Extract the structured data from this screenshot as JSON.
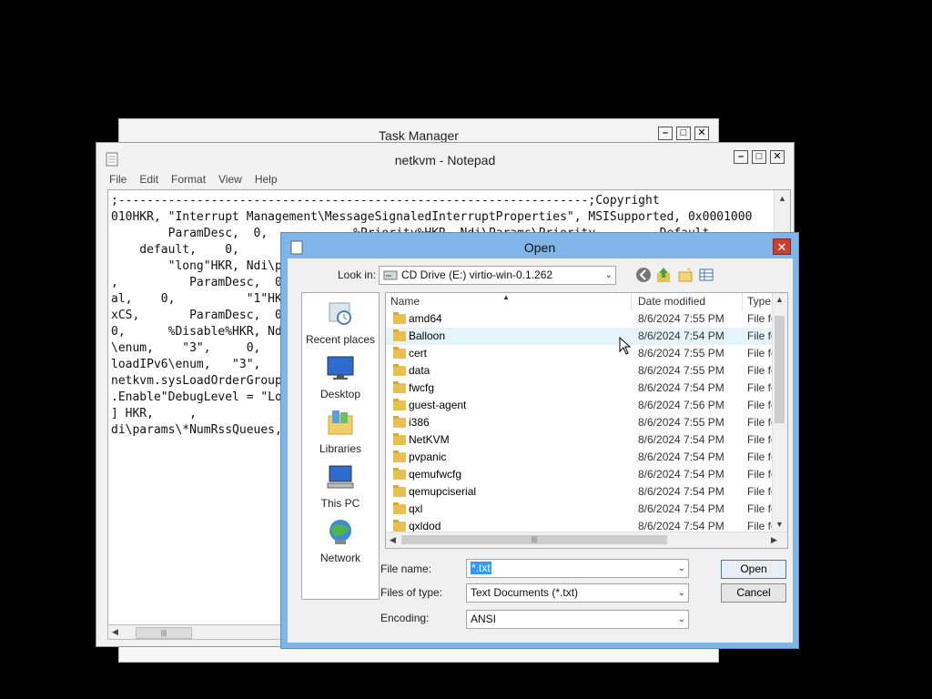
{
  "taskmanager": {
    "title": "Task Manager"
  },
  "notepad": {
    "title": "netkvm - Notepad",
    "menu": [
      "File",
      "Edit",
      "Format",
      "View",
      "Help"
    ],
    "text": ";------------------------------------------------------------------;Copyright\n010HKR, \"Interrupt Management\\MessageSignaledInterruptProperties\", MSISupported, 0x0001000\n        ParamDesc,  0,            %Priority%HKR, Ndi\\Params\\Priority,        Default\n    default,    0,\n        \"long\"HKR, Ndi\\p\n,          ParamDesc,  0,\nal,    0,          \"1\"HKR\nxCS,       ParamDesc,  0\n0,      %Disable%HKR, Nd\n\\enum,    \"3\",     0,\nloadIPv6\\enum,   \"3\",\nnetkvm.sysLoadOrderGroup\n.Enable\"DebugLevel = \"Lo\n] HKR,     ,\ndi\\params\\*NumRssQueues,"
  },
  "dialog": {
    "title": "Open",
    "look_in_label": "Look in:",
    "look_in_value": "CD Drive (E:) virtio-win-0.1.262",
    "places": [
      "Recent places",
      "Desktop",
      "Libraries",
      "This PC",
      "Network"
    ],
    "columns": {
      "name": "Name",
      "date": "Date modified",
      "type": "Type"
    },
    "files": [
      {
        "name": "amd64",
        "date": "8/6/2024 7:55 PM",
        "type": "File fol"
      },
      {
        "name": "Balloon",
        "date": "8/6/2024 7:54 PM",
        "type": "File fol"
      },
      {
        "name": "cert",
        "date": "8/6/2024 7:55 PM",
        "type": "File fol"
      },
      {
        "name": "data",
        "date": "8/6/2024 7:55 PM",
        "type": "File fol"
      },
      {
        "name": "fwcfg",
        "date": "8/6/2024 7:54 PM",
        "type": "File fol"
      },
      {
        "name": "guest-agent",
        "date": "8/6/2024 7:56 PM",
        "type": "File fol"
      },
      {
        "name": "i386",
        "date": "8/6/2024 7:55 PM",
        "type": "File fol"
      },
      {
        "name": "NetKVM",
        "date": "8/6/2024 7:54 PM",
        "type": "File fol"
      },
      {
        "name": "pvpanic",
        "date": "8/6/2024 7:54 PM",
        "type": "File fol"
      },
      {
        "name": "qemufwcfg",
        "date": "8/6/2024 7:54 PM",
        "type": "File fol"
      },
      {
        "name": "qemupciserial",
        "date": "8/6/2024 7:54 PM",
        "type": "File fol"
      },
      {
        "name": "qxl",
        "date": "8/6/2024 7:54 PM",
        "type": "File fol"
      },
      {
        "name": "qxldod",
        "date": "8/6/2024 7:54 PM",
        "type": "File fol"
      }
    ],
    "filename_label": "File name:",
    "filename_value": "*.txt",
    "filetype_label": "Files of type:",
    "filetype_value": "Text Documents (*.txt)",
    "encoding_label": "Encoding:",
    "encoding_value": "ANSI",
    "open_label": "Open",
    "cancel_label": "Cancel"
  }
}
